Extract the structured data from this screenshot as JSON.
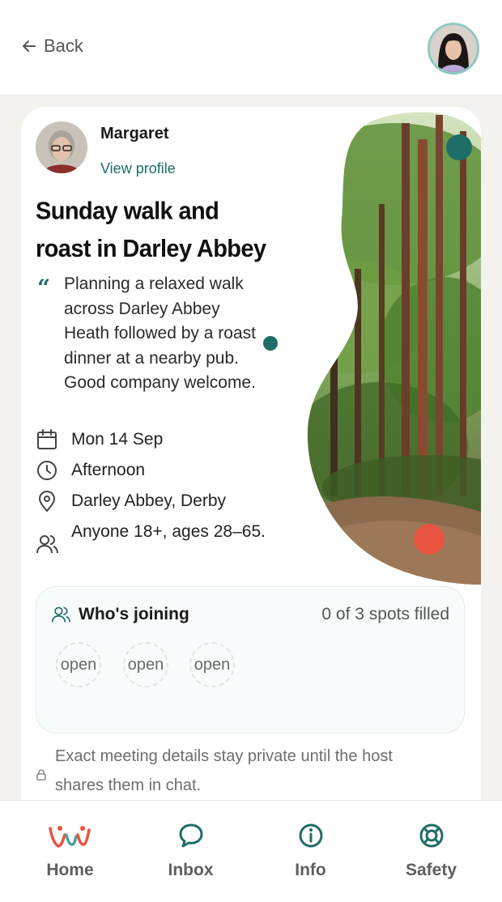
{
  "header": {
    "back_label": "Back",
    "user_avatar": "user-avatar"
  },
  "host": {
    "name": "Margaret",
    "view_profile_label": "View profile"
  },
  "event": {
    "title": "Sunday walk and roast in Darley Abbey",
    "description": "Planning a relaxed walk across Darley Abbey Heath followed by a roast dinner at a nearby pub. Good company welcome.",
    "date": "Mon 14 Sep",
    "time": "Afternoon",
    "location": "Darley Abbey, Derby",
    "audience": "Anyone 18+, ages 28–65."
  },
  "joining": {
    "heading": "Who's joining",
    "spots_status": "0 of 3 spots filled",
    "spots": [
      "open",
      "open",
      "open"
    ]
  },
  "privacy_note": "Exact meeting details stay private until the host shares them in chat.",
  "tabs": [
    {
      "label": "Home",
      "icon": "home-logo-icon"
    },
    {
      "label": "Inbox",
      "icon": "chat-bubble-icon"
    },
    {
      "label": "Info",
      "icon": "info-circle-icon"
    },
    {
      "label": "Safety",
      "icon": "lifebuoy-icon"
    }
  ],
  "colors": {
    "accent": "#1f6d67",
    "coral": "#e8543f",
    "background": "#f4f2ef"
  }
}
